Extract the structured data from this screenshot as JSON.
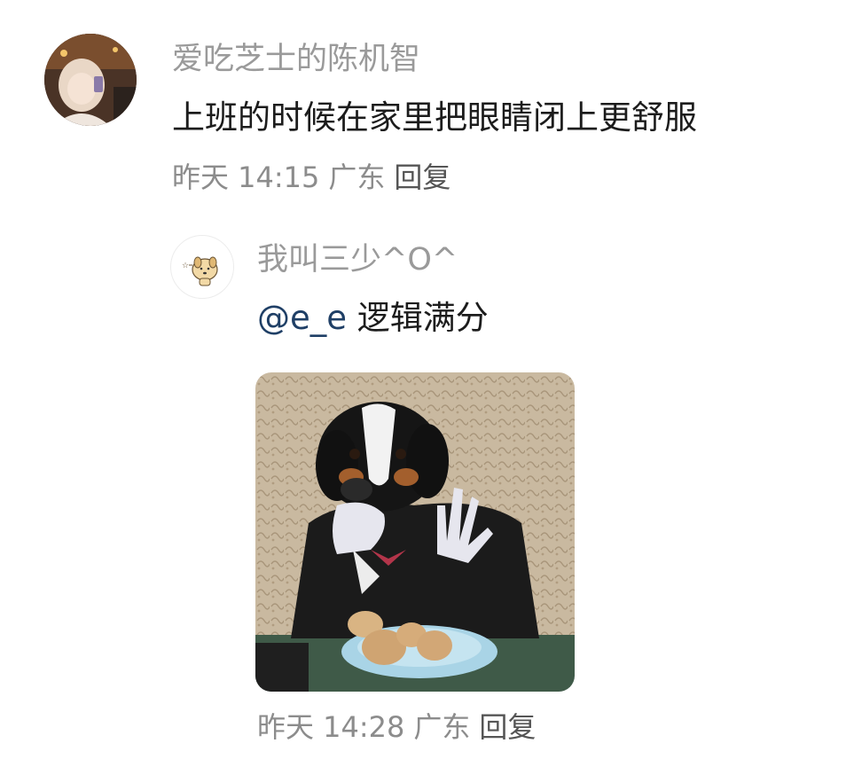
{
  "comment": {
    "username": "爱吃芝士的陈机智",
    "text": "上班的时候在家里把眼睛闭上更舒服",
    "time": "昨天 14:15",
    "location": "广东",
    "reply_label": "回复"
  },
  "reply": {
    "username": "我叫三少^O^",
    "mention": "@e_e",
    "text": "逻辑满分",
    "time": "昨天 14:28",
    "location": "广东",
    "reply_label": "回复",
    "image_icon": "dog-in-suit-photo"
  },
  "colors": {
    "username": "#9a9a9a",
    "meta": "#8c8c8c",
    "mention": "#1f3f66"
  }
}
